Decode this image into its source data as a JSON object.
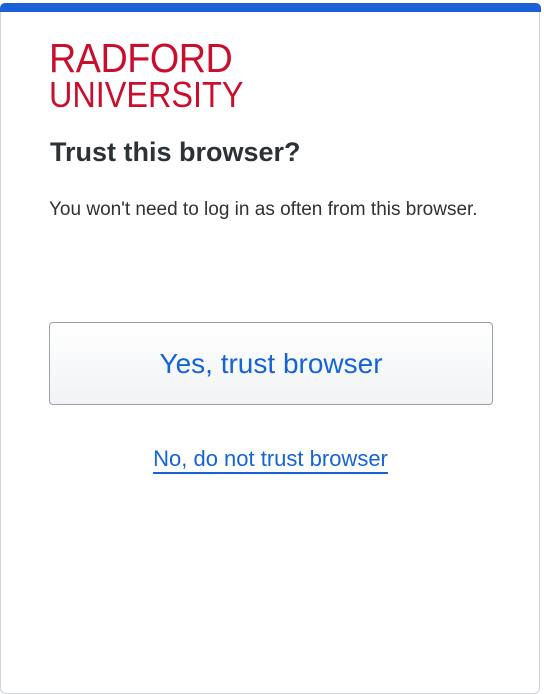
{
  "brand": {
    "line1": "RADFORD",
    "line2": "UNIVERSITY",
    "color": "#c8102e"
  },
  "accent_color": "#1b5fd9",
  "link_color": "#1464d6",
  "prompt": {
    "title": "Trust this browser?",
    "description": "You won't need to log in as often from this browser."
  },
  "actions": {
    "trust_label": "Yes, trust browser",
    "decline_label": "No, do not trust browser"
  }
}
